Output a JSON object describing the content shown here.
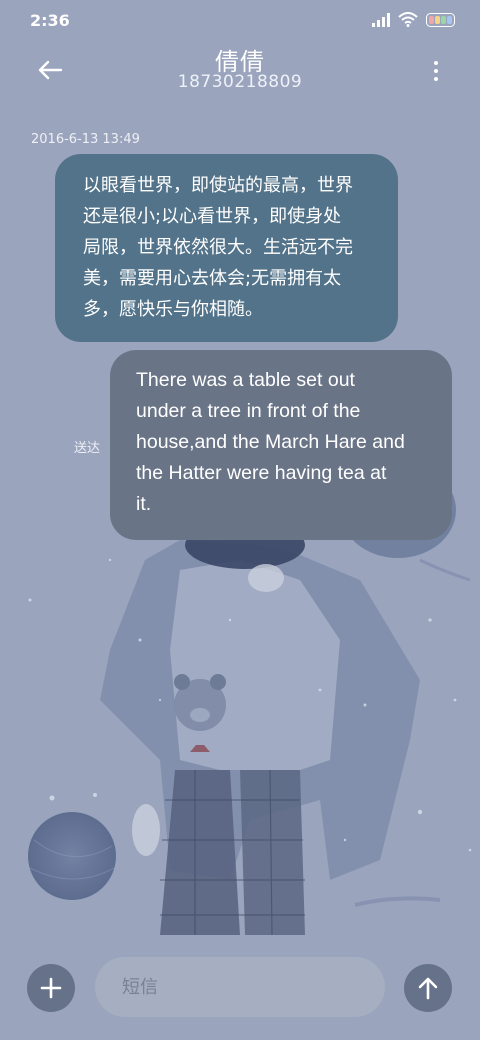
{
  "status_bar": {
    "time": "2:36",
    "icons": [
      "signal-icon",
      "wifi-icon",
      "battery-icon"
    ]
  },
  "header": {
    "contact_name": "倩倩",
    "contact_number": "18730218809",
    "back_icon": "arrow-left-icon",
    "menu_icon": "more-vertical-icon"
  },
  "conversation": {
    "timestamp": "2016-6-13 13:49",
    "received_message": {
      "lines": [
        "以眼看世界，即使站的最高，世界",
        "还是很小;以心看世界，即使身处",
        "局限，世界依然很大。生活远不完",
        "美，需要用心去体会;无需拥有太",
        "多，愿快乐与你相随。"
      ]
    },
    "sent_message": {
      "lines": [
        "There was a table set out",
        "under a tree in front of the",
        "house,and the March Hare and",
        "the Hatter were having tea at",
        "it."
      ],
      "status": "送达"
    }
  },
  "composer": {
    "placeholder": "短信",
    "add_icon": "plus-icon",
    "send_icon": "arrow-up-icon"
  },
  "colors": {
    "background": "#9aa4bd",
    "received_bubble": "#52738a",
    "sent_bubble": "#6a7487",
    "button": "#66718a"
  }
}
